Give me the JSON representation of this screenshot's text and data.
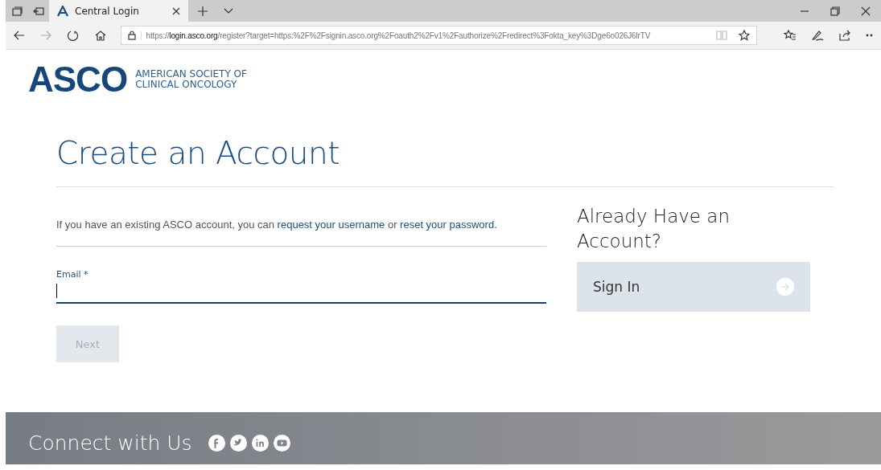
{
  "browser": {
    "tab": {
      "title": "Central Login",
      "selected": true
    },
    "address": {
      "host": "login.asco.org",
      "rest": "/register?target=https:%2F%2Fsignin.asco.org%2Foauth2%2Fv1%2Fauthorize%2Fredirect%3Fokta_key%3Dge6o026J6lrTV",
      "scheme": "https://"
    }
  },
  "logo": {
    "mark": "ASCO",
    "line_1": "AMERICAN SOCIETY OF",
    "line_2": "CLINICAL ONCOLOGY"
  },
  "heading": "Create an Account",
  "intro": {
    "before": "If you have an existing ASCO account, you can ",
    "link_1": "request your username",
    "middle": " or ",
    "link_2": "reset your password."
  },
  "email": {
    "label": "Email *"
  },
  "next_button": {
    "label": "Next",
    "disabled": true
  },
  "sidebar": {
    "title": "Already Have an Account?",
    "sign_in": "Sign In"
  },
  "footer": {
    "title": "Connect with Us",
    "social": [
      {
        "kind": "facebook"
      },
      {
        "kind": "twitter"
      },
      {
        "kind": "linkedin"
      },
      {
        "kind": "youtube"
      }
    ]
  }
}
